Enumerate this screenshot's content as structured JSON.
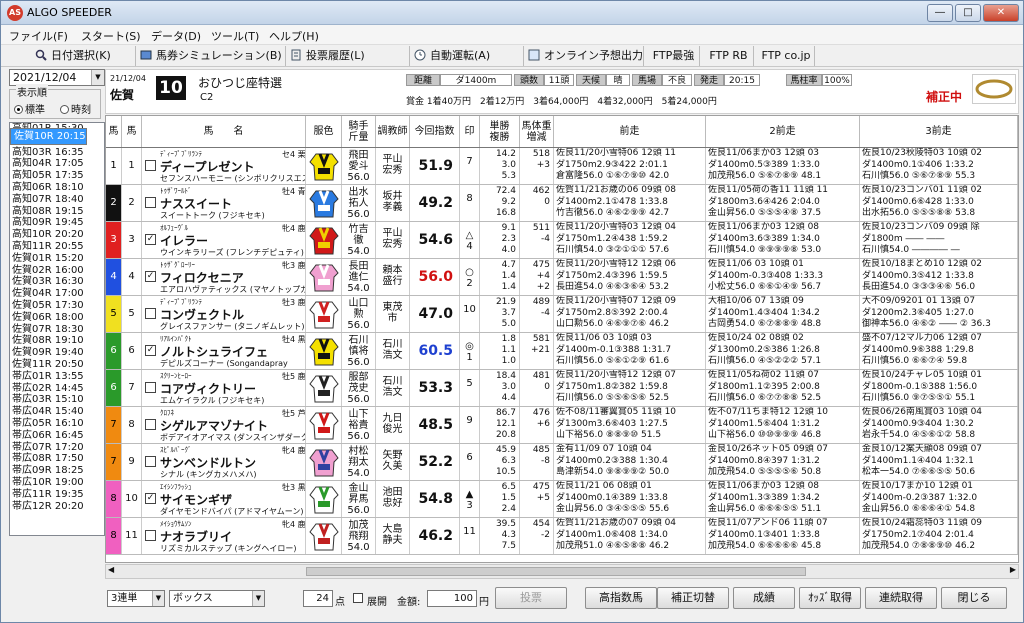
{
  "window": {
    "title": "ALGO SPEEDER",
    "app_icon": "AS",
    "buttons": [
      "―",
      "□",
      "✕"
    ]
  },
  "menu": [
    "ファイル(F)",
    "スタート(S)",
    "データ(D)",
    "ツール(T)",
    "ヘルプ(H)"
  ],
  "toolbar": [
    {
      "label": "日付選択(K)",
      "icon": "search-icon"
    },
    {
      "label": "馬券シミュレーション(B)",
      "icon": "ticket-icon"
    },
    {
      "label": "投票履歴(L)",
      "icon": "history-icon"
    },
    {
      "label": "自動運転(A)",
      "icon": "clock-icon"
    },
    {
      "label": "オンライン予想出力",
      "icon": "output-icon"
    },
    {
      "label": "FTP最強",
      "icon": ""
    },
    {
      "label": "FTP RB",
      "icon": ""
    },
    {
      "label": "FTP co.jp",
      "icon": ""
    }
  ],
  "left": {
    "date": "2021/12/04",
    "order_label": "表示順",
    "order_options": [
      "標準",
      "時刻"
    ],
    "races": [
      "高知01R 15:30",
      "高知02R 16:05",
      "高知03R 16:35",
      "高知04R 17:05",
      "高知05R 17:35",
      "高知06R 18:10",
      "高知07R 18:40",
      "高知08R 19:15",
      "高知09R 19:45",
      "高知10R 20:20",
      "高知11R 20:55",
      "佐賀01R 15:20",
      "佐賀02R 16:00",
      "佐賀03R 16:30",
      "佐賀04R 17:00",
      "佐賀05R 17:30",
      "佐賀06R 18:00",
      "佐賀07R 18:30",
      "佐賀08R 19:10",
      "佐賀09R 19:40",
      "佐賀10R 20:15",
      "佐賀11R 20:50",
      "帯広01R 13:55",
      "帯広02R 14:45",
      "帯広03R 15:10",
      "帯広04R 15:40",
      "帯広05R 16:10",
      "帯広06R 16:45",
      "帯広07R 17:20",
      "帯広08R 17:50",
      "帯広09R 18:25",
      "帯広10R 19:00",
      "帯広11R 19:35",
      "帯広12R 20:20"
    ],
    "selected_index": 20
  },
  "header": {
    "date": "21/12/04",
    "venue": "佐賀",
    "race_no": "10",
    "race_name": "おひつじ座特選",
    "grade": "C2",
    "distance_label": "距離",
    "distance": "ダ1400m",
    "heads_label": "頭数",
    "heads": "11頭",
    "weather_label": "天候",
    "weather": "晴",
    "track_label": "馬場",
    "track": "不良",
    "post_label": "発走",
    "post": "20:15",
    "rate_label": "馬柱率",
    "rate": "100%",
    "prize": "賞金 1着40万円　2着12万円　3着64,000円　4着32,000円　5着24,000円",
    "correction": "補正中"
  },
  "columns": [
    "馬",
    "馬",
    "馬　　名",
    "服色",
    "騎手\n斤量",
    "調教師",
    "今回指数",
    "印",
    "単勝\n複勝",
    "馬体重\n増減",
    "前走",
    "2前走",
    "3前走"
  ],
  "frame_colors": [
    "#ffffff",
    "#111111",
    "#e02020",
    "#2050e0",
    "#f0e020",
    "#2a9a2a",
    "#2a9a2a",
    "#f08a10",
    "#f08a10",
    "#f060c0",
    "#f060c0"
  ],
  "horses": [
    {
      "frame": "1",
      "no": "1",
      "check": false,
      "sire": "ﾃﾞｨｰﾌﾟﾌﾞﾘﾗﾝﾃ",
      "name": "ディープレゼント",
      "dam": "セフンスハーモニー (シンボリクリスエス)",
      "sex": "セ4 栗",
      "jockey": "飛田\n愛斗\n56.0",
      "trainer": "平山\n宏秀",
      "index": "51.9",
      "index_color": "#111",
      "mark": "7",
      "odds": "14.2\n3.0\n5.3",
      "weight": "518\n+3",
      "p1": [
        "佐良11/20小雪特06 12頭 11",
        "ダ1750m2.9③422 2:01.1",
        "倉富隆56.0 ①⑥⑦⑨⑩ 42.0"
      ],
      "p2": [
        "佐良11/06まか03 12頭 03",
        "ダ1400m0.5③389 1:33.0",
        "加茂飛56.0 ⑤⑥⑦⑧⑨ 48.1"
      ],
      "p3": [
        "佐良10/23秋陵特03 10頭 02",
        "ダ1400m0.1①406 1:33.2",
        "石川慎56.0 ⑤⑥⑦⑧⑨ 55.3"
      ],
      "colors": [
        "#f4e000",
        "#111"
      ]
    },
    {
      "frame": "2",
      "no": "2",
      "check": false,
      "sire": "ﾄｩｻﾞﾜｰﾙﾄﾞ",
      "name": "ナススイート",
      "dam": "スイートトーク (フジキセキ)",
      "sex": "牡4 青",
      "jockey": "出水\n拓人\n56.0",
      "trainer": "坂井\n孝義",
      "index": "49.2",
      "index_color": "#111",
      "mark": "8",
      "odds": "72.4\n9.2\n16.8",
      "weight": "462\n0",
      "p1": [
        "佐賀11/21お歳の06 09頭 08",
        "ダ1400m2.1①478 1:33.8",
        "竹吉徹56.0 ④⑥②⑨⑨ 42.7"
      ],
      "p2": [
        "佐良11/05荷の香11 11頭 11",
        "ダ1800m3.6④426 2:04.0",
        "金山昇56.0 ⑤⑤⑤④⑧ 37.5"
      ],
      "p3": [
        "佐良10/23コンバ01 11頭 02",
        "ダ1400m0.6⑥428 1:33.0",
        "出水拓56.0 ⑤⑤⑤⑧⑧ 53.8"
      ],
      "colors": [
        "#2a7ae0",
        "#ffffff"
      ]
    },
    {
      "frame": "3",
      "no": "3",
      "check": true,
      "sire": "ｵﾙﾌｪｰｳﾞﾙ",
      "name": "イレラー",
      "dam": "ウインキラリーズ (フレンチデピュティ)",
      "sex": "牝4 鹿",
      "jockey": "竹吉\n徹\n54.0",
      "trainer": "平山\n宏秀",
      "index": "54.6",
      "index_color": "#111",
      "mark": "△\n4",
      "odds": "9.1\n2.3\n4.0",
      "weight": "511\n-4",
      "p1": [
        "佐良11/20小雪特03 12頭 04",
        "ダ1750m1.2④438 1:59.2",
        "石川慎54.0 ③②①①① 57.6"
      ],
      "p2": [
        "佐良11/06まか03 12頭 08",
        "ダ1400m3.6③389 1:34.0",
        "石川慎54.0 ⑨⑨⑨⑨⑧ 53.0"
      ],
      "p3": [
        "佐良10/23コンバ09 09頭 除",
        "ダ1800m ―― ――",
        "石川慎54.0 ―――― ―"
      ],
      "colors": [
        "#d01818",
        "#f0d000"
      ]
    },
    {
      "frame": "4",
      "no": "4",
      "check": true,
      "sire": "ﾄｩｻﾞｸﾞﾛｰﾘｰ",
      "name": "フィロクセニア",
      "dam": "エアロハヴァティックス (マヤノトップガン)",
      "sex": "牝3 鹿",
      "jockey": "長田\n進仁\n54.0",
      "trainer": "頼本\n盛行",
      "index": "56.0",
      "index_color": "#d01010",
      "mark": "○\n2",
      "odds": "4.7\n1.4\n1.4",
      "weight": "475\n+4\n+2",
      "p1": [
        "佐良11/20小雪特12 12頭 06",
        "ダ1750m2.4③396 1:59.5",
        "長田進54.0 ④⑥③⑥④ 53.2"
      ],
      "p2": [
        "佐良11/06 03 10頭 01",
        "ダ1400m-0.3③408 1:33.3",
        "小松丈56.0 ⑥⑥①④⑨ 56.7"
      ],
      "p3": [
        "佐良10/18まとめ10 12頭 02",
        "ダ1400m0.3⑤412 1:33.8",
        "長田進54.0 ③③③④⑥ 56.0"
      ],
      "colors": [
        "#f0a0d0",
        "#ffffff"
      ]
    },
    {
      "frame": "5",
      "no": "5",
      "check": false,
      "sire": "ﾃﾞｨｰﾌﾟﾌﾞﾘﾗﾝﾃ",
      "name": "コンヴェクトル",
      "dam": "グレイスファンサー (タニノギムレット)",
      "sex": "牡3 鹿",
      "jockey": "山口\n勲\n56.0",
      "trainer": "東茂\n市",
      "index": "47.0",
      "index_color": "#111",
      "mark": "10",
      "odds": "21.9\n3.7\n5.0",
      "weight": "489\n-4",
      "p1": [
        "佐良11/20小雪特07 12頭 09",
        "ダ1750m2.8⑤392 2:00.4",
        "山口勲56.0 ④⑥⑨⑦⑥ 46.2"
      ],
      "p2": [
        "大相10/06 07 13頭 09",
        "ダ1400m1.4③404 1:34.2",
        "古岡勇54.0 ⑥⑦⑧⑧⑨ 48.8"
      ],
      "p3": [
        "大不09/09201 01 13頭 07",
        "ダ1200m2.3⑥405 1:27.0",
        "御神本56.0 ④⑥② ―― ② 36.3"
      ],
      "colors": [
        "#ffffff",
        "#d02020"
      ]
    },
    {
      "frame": "6",
      "no": "6",
      "check": true,
      "sire": "ﾘｱﾙｲﾝﾊﾟｸﾄ",
      "name": "ノルトシュライフェ",
      "dam": "デピルズコーナー (Songandapray",
      "sex": "牡4 黒鹿",
      "jockey": "石川\n慎将\n56.0",
      "trainer": "石川\n浩文",
      "index": "60.5",
      "index_color": "#1e40d0",
      "mark": "◎\n1",
      "odds": "1.8\n1.1\n1.0",
      "weight": "581\n+21",
      "p1": [
        "佐良11/06 03 10頭 03",
        "ダ1400m-0.1③388 1:31.7",
        "石川慎56.0 ⑤⑥①②⑨ 61.6"
      ],
      "p2": [
        "佐良10/24 02 08頭 02",
        "ダ1300m0.2⑤386 1:26.8",
        "石川慎56.0 ④⑤②②② 57.1"
      ],
      "p3": [
        "盛不07/12マル力06 12頭 07",
        "ダ1400m0.9⑥388 1:29.8",
        "石川慎56.0 ⑥⑥⑦④ 59.8"
      ],
      "colors": [
        "#f4e000",
        "#111"
      ]
    },
    {
      "frame": "6",
      "no": "7",
      "check": false,
      "sire": "ｽｸﾘｰﾝﾋｰﾛｰ",
      "name": "コアヴィクトリー",
      "dam": "エムケイラクル (フジキセキ)",
      "sex": "牡5 鹿",
      "jockey": "服部\n茂史\n56.0",
      "trainer": "石川\n浩文",
      "index": "53.3",
      "index_color": "#111",
      "mark": "5",
      "odds": "18.4\n3.0\n4.4",
      "weight": "481\n0",
      "p1": [
        "佐良11/20小雪特12 12頭 07",
        "ダ1750m1.8②382 1:59.8",
        "石川慎56.0 ⑤⑤⑥⑤⑥ 52.5"
      ],
      "p2": [
        "佐良11/05ね荷02 11頭 07",
        "ダ1800m1.1②395 2:00.8",
        "石川慎56.0 ⑥⑦⑦⑧⑧ 52.5"
      ],
      "p3": [
        "佐良10/24チャレ05 10頭 01",
        "ダ1800m-0.1⑤388 1:56.0",
        "石川慎56.0 ⑨⑦⑤⑤① 55.1"
      ],
      "colors": [
        "#ffffff",
        "#222"
      ]
    },
    {
      "frame": "7",
      "no": "8",
      "check": false,
      "sire": "ｸﾛﾌﾈ",
      "name": "シゲルアマゾナイト",
      "dam": "ボデアイオアイマス (ダンスインザダーク)",
      "sex": "牡5 芦鹿",
      "jockey": "山下\n裕貴\n56.0",
      "trainer": "九日\n俊光",
      "index": "48.5",
      "index_color": "#111",
      "mark": "9",
      "odds": "86.7\n12.1\n20.8",
      "weight": "476\n+6",
      "p1": [
        "佐不08/11審翼賞05 11頭 10",
        "ダ1300m3.6⑥403 1:27.5",
        "山下裕56.0 ⑧⑧⑨⑩ 51.5"
      ],
      "p2": [
        "佐不07/11ちま特12 12頭 10",
        "ダ1400m1.5⑥404 1:31.2",
        "山下裕56.0 ⑩⑩⑨⑨⑨ 46.8"
      ],
      "p3": [
        "佐良06/26南風賞03 10頭 04",
        "ダ1400m0.9③404 1:30.2",
        "岩永千54.0 ④⑤⑥①② 58.8"
      ],
      "colors": [
        "#ffffff",
        "#d01818"
      ]
    },
    {
      "frame": "7",
      "no": "9",
      "check": false,
      "sire": "ｽﾋﾟﾙﾊﾞｰｸﾞ",
      "name": "サンベンドルトン",
      "dam": "シナル (キングカメハメハ)",
      "sex": "牝4 鹿",
      "jockey": "村松\n翔太\n54.0",
      "trainer": "矢野\n久美",
      "index": "52.2",
      "index_color": "#111",
      "mark": "6",
      "odds": "45.9\n6.3\n10.5",
      "weight": "485\n-8",
      "p1": [
        "金有11/09 07 10頭 04",
        "ダ1400m0.2③388 1:30.4",
        "島津新54.0 ⑨⑧⑨⑨② 50.0"
      ],
      "p2": [
        "金良10/26ネット05 09頭 07",
        "ダ1400m0.8④397 1:31.2",
        "加茂飛54.0 ⑤⑤⑤⑤⑥ 50.8"
      ],
      "p3": [
        "金良10/12案天顯08 09頭 07",
        "ダ1400m1.1④404 1:32.1",
        "松本一54.0 ⑦⑥⑥⑤⑤ 50.6"
      ],
      "colors": [
        "#f0a0d0",
        "#3040a0"
      ]
    },
    {
      "frame": "8",
      "no": "10",
      "check": true,
      "sire": "ｴｲｼﾝﾌﾗｯｼｭ",
      "name": "サイモンギザ",
      "dam": "ダイヤモンドバイパ (アドマイヤムーン)",
      "sex": "牡3 黒鹿",
      "jockey": "金山\n昇馬\n56.0",
      "trainer": "池田\n忠好",
      "index": "54.8",
      "index_color": "#111",
      "mark": "▲\n3",
      "odds": "6.5\n1.5\n2.4",
      "weight": "475\n+5",
      "p1": [
        "佐良11/21 06 08頭 01",
        "ダ1400m0.1④389 1:33.8",
        "金山昇56.0 ③④⑤⑤⑤ 55.6"
      ],
      "p2": [
        "佐良11/06まか03 12頭 08",
        "ダ1400m1.3③389 1:34.2",
        "金山昇56.0 ⑥⑥⑥⑤⑤ 51.1"
      ],
      "p3": [
        "佐良10/17まか10 12頭 01",
        "ダ1400m-0.2③387 1:32.0",
        "金山昇56.0 ⑥⑥⑥④① 54.8"
      ],
      "colors": [
        "#ffffff",
        "#2a9a2a"
      ]
    },
    {
      "frame": "8",
      "no": "11",
      "check": false,
      "sire": "ﾒｲｼｮｳｻﾑｿﾝ",
      "name": "ナオラブリイ",
      "dam": "リズミカルステップ (キングヘイロー)",
      "sex": "牝4 鹿",
      "jockey": "加茂\n飛翔\n54.0",
      "trainer": "大島\n静夫",
      "index": "46.2",
      "index_color": "#111",
      "mark": "11",
      "odds": "39.5\n4.3\n7.5",
      "weight": "454\n-2",
      "p1": [
        "佐賀11/21お歳の07 09頭 04",
        "ダ1400m1.0⑥408 1:34.0",
        "加茂飛51.0 ④⑥⑤⑧⑧ 46.2"
      ],
      "p2": [
        "佐良11/07アンド06 11頭 07",
        "ダ1400m0.1③401 1:33.8",
        "加茂飛54.0 ⑥⑥⑥⑥⑥ 45.8"
      ],
      "p3": [
        "佐良10/24霜蕊特03 11頭 09",
        "ダ1750m2.1⑦404 2:01.4",
        "加茂飛54.0 ⑦⑧⑧⑨⑩ 46.2"
      ],
      "colors": [
        "#ffffff",
        "#c02020"
      ]
    }
  ],
  "bottom": {
    "bet_type": "3連単",
    "bet_method": "ボックス",
    "points": "24",
    "points_unit": "点",
    "expand_label": "展開",
    "amount_label": "金額:",
    "amount": "100",
    "amount_unit": "円",
    "vote": "投票",
    "buttons": [
      "高指数馬",
      "補正切替",
      "成績",
      "ｵｯｽﾞ取得",
      "連続取得",
      "閉じる"
    ]
  }
}
